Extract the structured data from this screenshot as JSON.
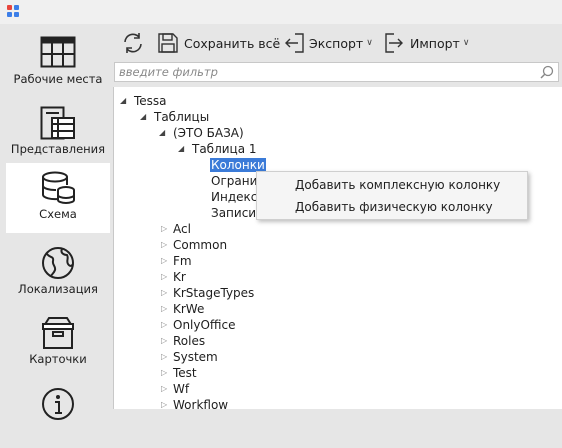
{
  "sidebar": {
    "items": [
      {
        "label": "Рабочие места",
        "icon": "workplaces-icon"
      },
      {
        "label": "Представления",
        "icon": "views-icon"
      },
      {
        "label": "Схема",
        "icon": "database-schema-icon"
      },
      {
        "label": "Локализация",
        "icon": "globe-icon"
      },
      {
        "label": "Карточки",
        "icon": "cards-box-icon"
      },
      {
        "label": "",
        "icon": "info-icon"
      }
    ],
    "active": "Схема"
  },
  "toolbar": {
    "refresh_icon": "refresh-icon",
    "save_label": "Сохранить всё",
    "export_label": "Экспорт",
    "import_label": "Импорт"
  },
  "filter": {
    "placeholder": "введите фильтр",
    "value": ""
  },
  "tree": {
    "root": "Tessa",
    "tables": "Таблицы",
    "scheme": "(ЭТО БАЗА)",
    "table1": "Таблица 1",
    "table1_children": [
      "Колонки",
      "Огранич",
      "Индексы",
      "Записи"
    ],
    "schemes": [
      "Acl",
      "Common",
      "Fm",
      "Kr",
      "KrStageTypes",
      "KrWe",
      "OnlyOffice",
      "Roles",
      "System",
      "Test",
      "Wf",
      "Workflow"
    ]
  },
  "context_menu": {
    "items": [
      "Добавить комплексную колонку",
      "Добавить физическую колонку"
    ]
  },
  "colors": {
    "selection": "#3b7bd8",
    "active_sidebar": "#ffffff",
    "background": "#e6e6e6"
  }
}
